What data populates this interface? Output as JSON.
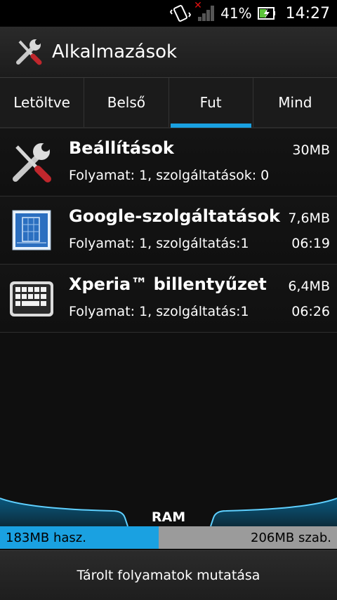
{
  "status": {
    "battery_percent": "41%",
    "time": "14:27",
    "icons": [
      "vibrate-icon",
      "signal-no-service-icon",
      "battery-charging-icon"
    ]
  },
  "header": {
    "title": "Alkalmazások",
    "icon": "tools-icon"
  },
  "tabs": [
    {
      "label": "Letöltve",
      "active": false
    },
    {
      "label": "Belső",
      "active": false
    },
    {
      "label": "Fut",
      "active": true
    },
    {
      "label": "Mind",
      "active": false
    }
  ],
  "processes": [
    {
      "name": "Beállítások",
      "subtitle": "Folyamat: 1, szolgáltatások: 0",
      "size": "30MB",
      "time": "",
      "icon": "settings-tools-icon"
    },
    {
      "name": "Google-szolgáltatások",
      "subtitle": "Folyamat: 1, szolgáltatás:1",
      "size": "7,6MB",
      "time": "06:19",
      "icon": "blueprint-icon"
    },
    {
      "name": "Xperia™ billentyűzet",
      "subtitle": "Folyamat: 1, szolgáltatás:1",
      "size": "6,4MB",
      "time": "06:26",
      "icon": "keyboard-icon"
    }
  ],
  "ram": {
    "label": "RAM",
    "used": "183MB hasz.",
    "free": "206MB szab.",
    "used_fraction": 0.47
  },
  "bottom_button": "Tárolt folyamatok mutatása",
  "colors": {
    "accent": "#1aa1e1",
    "free": "#9b9b9b"
  }
}
